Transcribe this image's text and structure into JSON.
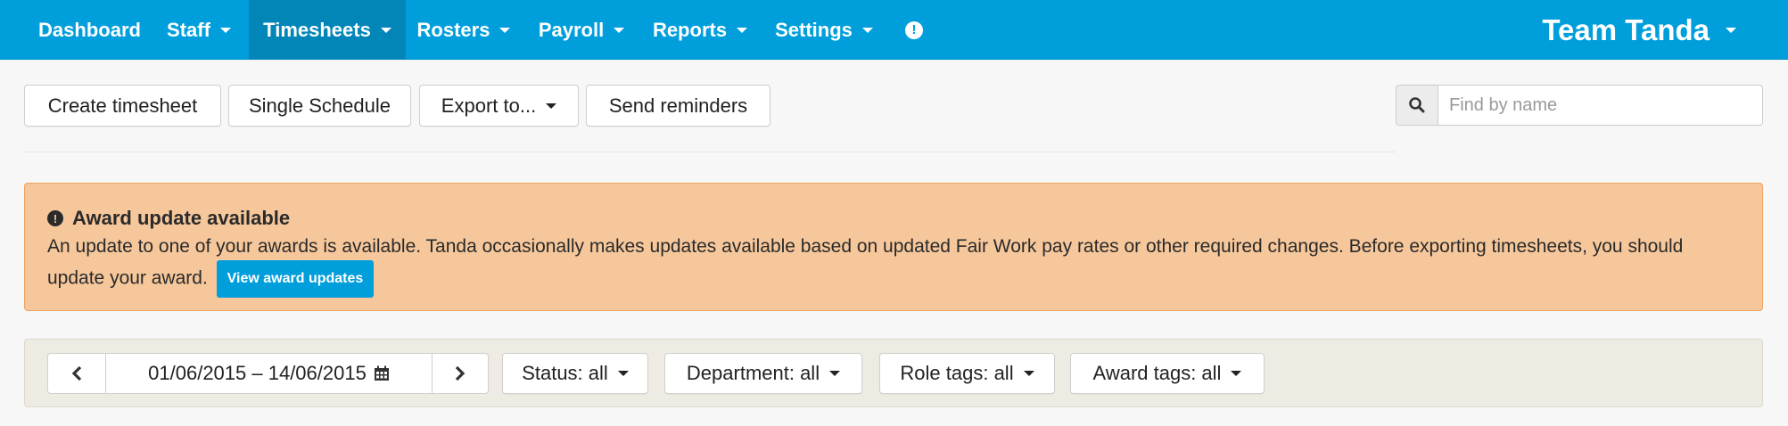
{
  "nav": {
    "dashboard": "Dashboard",
    "staff": "Staff",
    "timesheets": "Timesheets",
    "rosters": "Rosters",
    "payroll": "Payroll",
    "reports": "Reports",
    "settings": "Settings",
    "alert_icon": "!",
    "team": "Team Tanda"
  },
  "toolbar": {
    "create": "Create timesheet",
    "single": "Single Schedule",
    "export": "Export to...",
    "reminders": "Send reminders"
  },
  "search": {
    "placeholder": "Find by name",
    "icon": "search-icon"
  },
  "alert": {
    "title": "Award update available",
    "text": "An update to one of your awards is available. Tanda occasionally makes updates available based on updated Fair Work pay rates or other required changes. Before exporting timesheets, you should update your award.",
    "button": "View award updates"
  },
  "filters": {
    "date_range": "01/06/2015 – 14/06/2015",
    "prev": "‹",
    "next": "›",
    "status": "Status: all",
    "department": "Department: all",
    "role_tags": "Role tags: all",
    "award_tags": "Award tags: all"
  },
  "colors": {
    "navbar": "#009fdc",
    "nav_active": "#0286b8",
    "alert_bg": "#f6c79b",
    "alert_border": "#eea366",
    "filter_bg": "#eeebe3"
  }
}
